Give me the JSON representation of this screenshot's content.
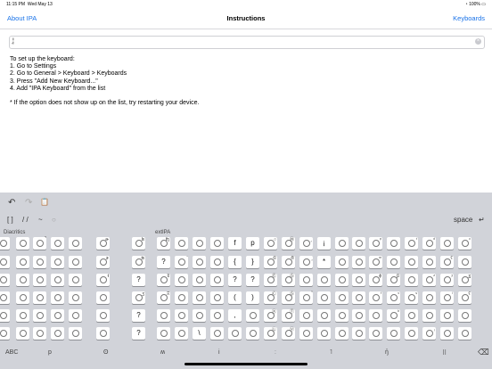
{
  "status": {
    "time": "11:15 PM",
    "date": "Wed May 13",
    "battery": "100%"
  },
  "nav": {
    "left": "About IPA",
    "title": "Instructions",
    "right": "Keyboards"
  },
  "field": {
    "value": "¦̣"
  },
  "instructions": [
    "To set up the keyboard:",
    "1. Go to Settings",
    "2. Go to General > Keyboard > Keyboards",
    "3. Press \"Add New Keyboard...\"",
    "4. Add \"IPA Keyboard\" from the list",
    "",
    "* If the option does not show up on the list, try restarting your device."
  ],
  "keyboard": {
    "toolbar": {
      "undo": "↶",
      "redo": "↷",
      "paste": "📋"
    },
    "row2": {
      "brackets": "[ ]",
      "slashes": "/ /",
      "tilde": "~",
      "space": "space",
      "return": "↵"
    },
    "sections": {
      "diacritics": "Diacritics",
      "extipa": "extIPA"
    },
    "bottom": {
      "abc": "ABC",
      "p": "p",
      "o": "ʘ",
      "m": "ʍ",
      "i": "i",
      "colon": "ː",
      "hook": "˥",
      "nasal": "ŋ̊",
      "dotsym": "⠿",
      "delete": "⌫"
    },
    "keys": [
      [
        "",
        "",
        "̚",
        "",
        "",
        "ɚ",
        "ʪ",
        "ʩ",
        "",
        "",
        "",
        "f",
        "p",
        "○",
        "Ⓝ",
        "¸",
        "¡",
        "",
        "",
        "ᵖ",
        "",
        "ᵗ",
        "ᵈ",
        "",
        "ᶜ"
      ],
      [
        "",
        "",
        "",
        "",
        "",
        "ɝ",
        "ʦ",
        "?",
        "̈",
        "",
        "",
        "{",
        "}",
        "©",
        "®",
        "̧",
        "*",
        "",
        "",
        "ᵐ",
        "",
        "",
        "",
        "ʕ",
        ""
      ],
      [
        "",
        "",
        "",
        "",
        "",
        "ŧ",
        "?",
        "ʬ",
        "",
        "",
        "",
        "?",
        "?",
        "Ⓔ",
        "Ⓢ",
        "",
        "",
        "",
        "",
        "ɸ",
        "β",
        "",
        "ᶻ",
        "ᶾ",
        "ʓ"
      ],
      [
        "",
        "",
        "",
        "",
        "",
        "",
        "ʒ",
        "ʭ",
        "",
        "",
        "",
        "(",
        ")",
        "Ⓒ",
        "Ⓢ",
        "̏",
        "",
        "",
        "",
        "ᶠ",
        "ᵛ",
        "ˢ",
        "",
        "ˡ",
        "ʕ"
      ],
      [
        "",
        "",
        "",
        "",
        "",
        "",
        "?",
        "",
        "",
        "",
        "",
        ",",
        "",
        "Ⓧ",
        "Ⓣ",
        "",
        "",
        "",
        "",
        "",
        "ᵇ",
        "",
        "",
        "",
        ""
      ],
      [
        "",
        "",
        "",
        "",
        "",
        "",
        "?",
        "",
        "",
        "\\",
        "",
        "",
        "",
        "Ⓛ",
        "Ⓥ",
        "",
        "",
        "",
        "",
        "",
        "",
        "",
        "ᵢ",
        "",
        ""
      ]
    ]
  }
}
